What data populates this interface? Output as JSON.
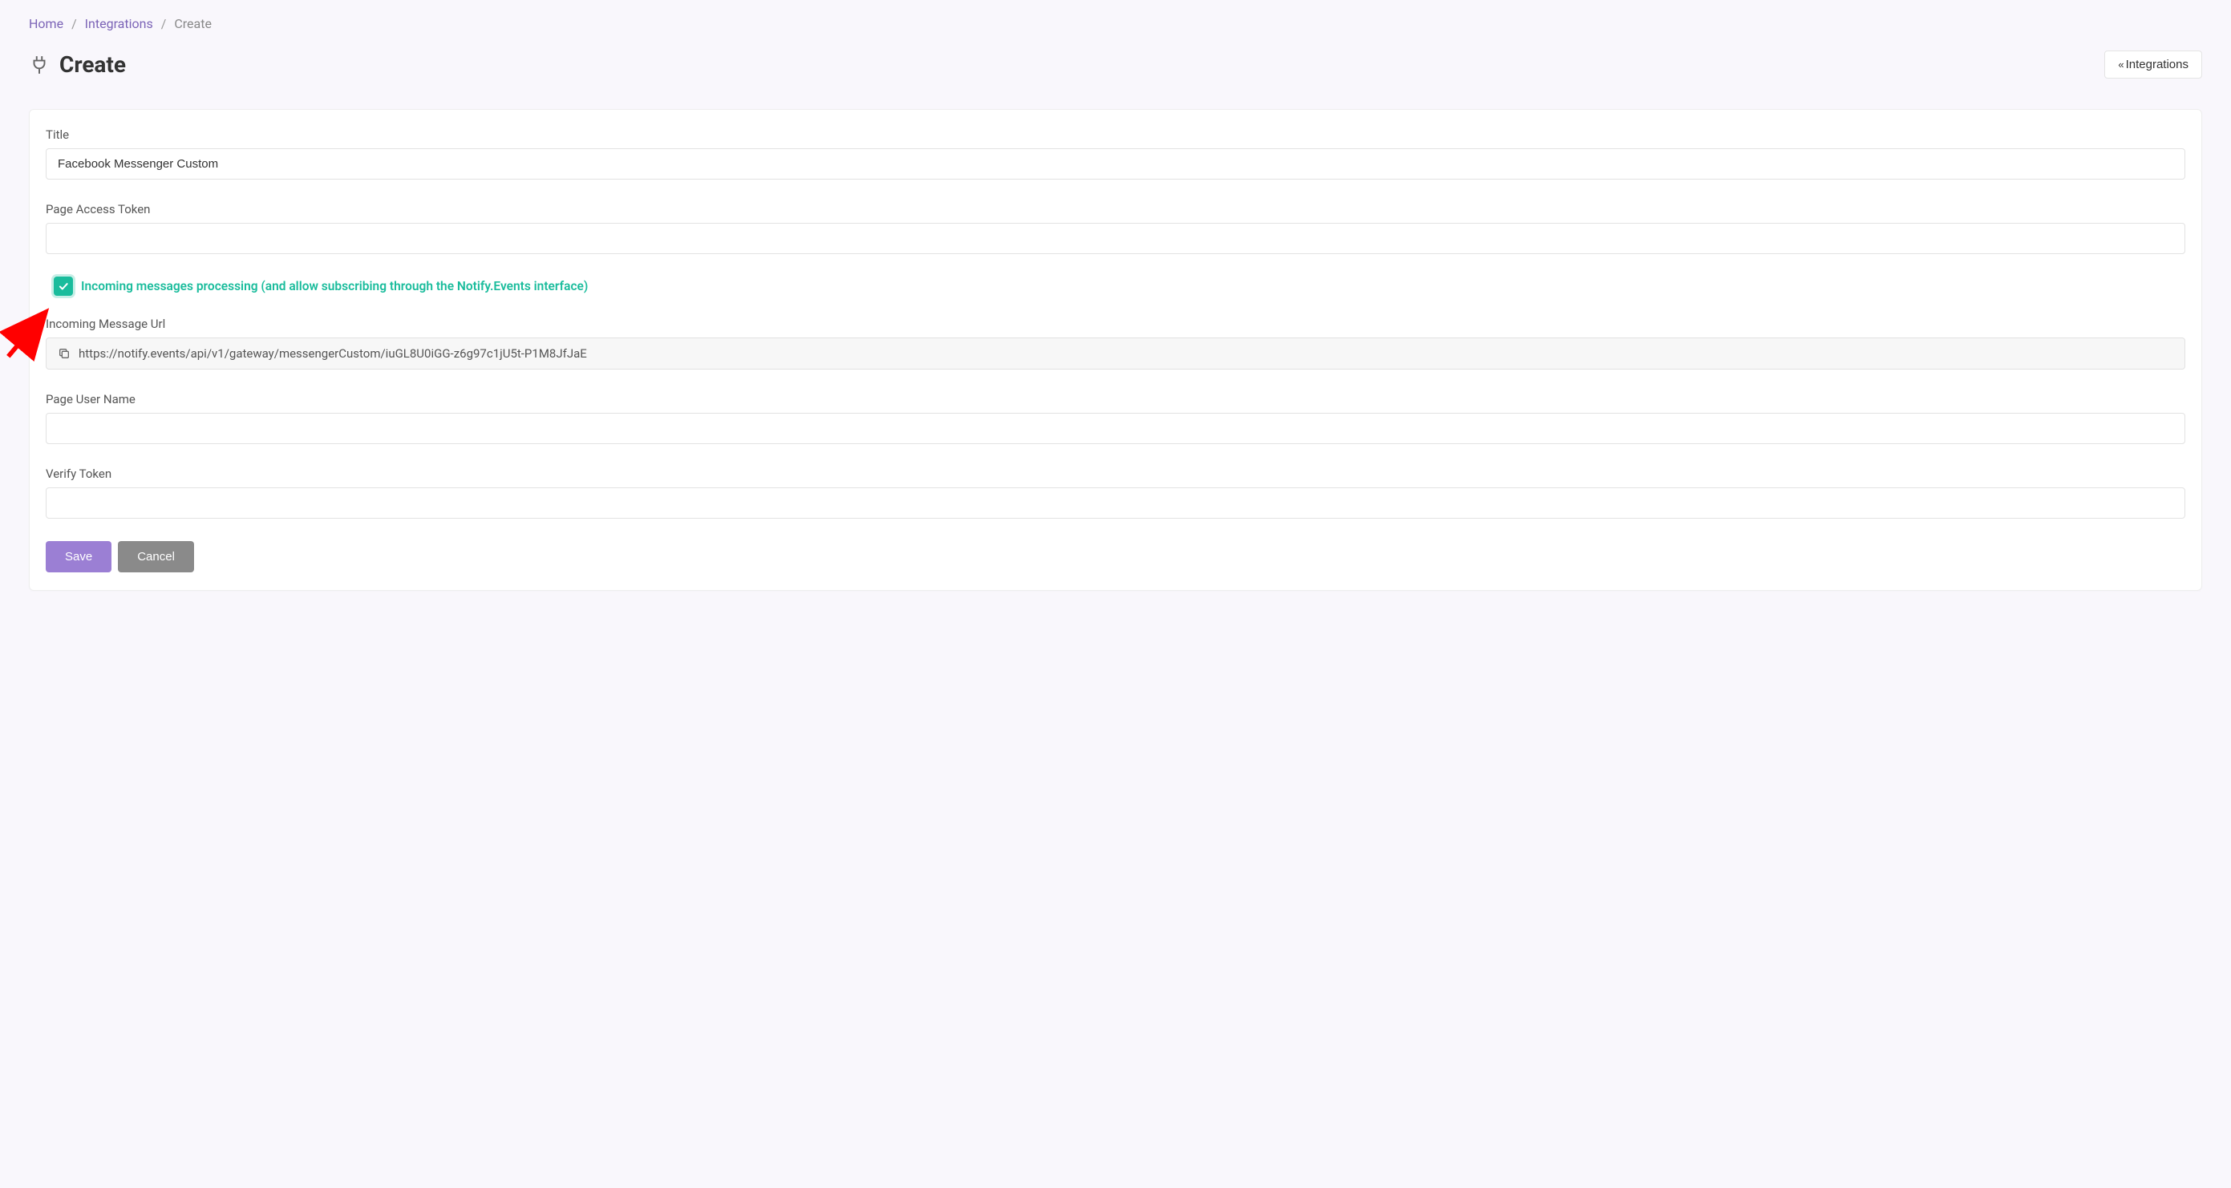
{
  "breadcrumb": {
    "home": "Home",
    "integrations": "Integrations",
    "current": "Create"
  },
  "header": {
    "title": "Create",
    "back_btn": "Integrations"
  },
  "form": {
    "title_label": "Title",
    "title_value": "Facebook Messenger Custom",
    "page_access_token_label": "Page Access Token",
    "page_access_token_value": "",
    "checkbox_label": "Incoming messages processing (and allow subscribing through the Notify.Events interface)",
    "incoming_url_label": "Incoming Message Url",
    "incoming_url_value": "https://notify.events/api/v1/gateway/messengerCustom/iuGL8U0iGG-z6g97c1jU5t-P1M8JfJaE",
    "page_user_name_label": "Page User Name",
    "page_user_name_value": "",
    "verify_token_label": "Verify Token",
    "verify_token_value": ""
  },
  "buttons": {
    "save": "Save",
    "cancel": "Cancel"
  }
}
